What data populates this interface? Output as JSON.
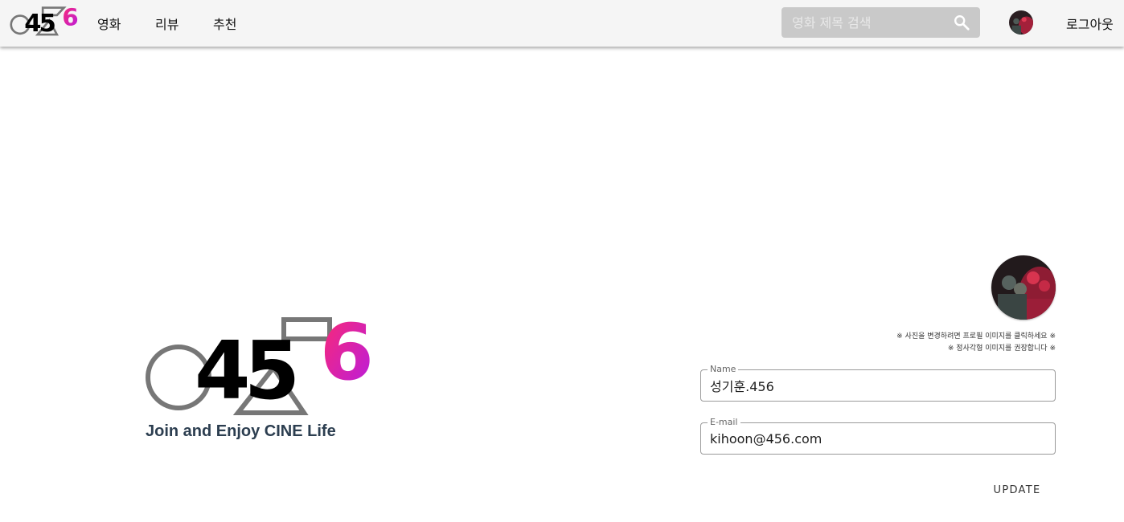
{
  "navbar": {
    "logo_text": "456",
    "items": [
      {
        "label": "영화"
      },
      {
        "label": "리뷰"
      },
      {
        "label": "추천"
      }
    ],
    "search": {
      "placeholder": "영화 제목 검색",
      "value": "",
      "icon": "search-icon"
    },
    "avatar_icon": "user-avatar",
    "logout_label": "로그아웃"
  },
  "brand": {
    "logo_text": "456",
    "tagline": "Join and Enjoy CINE Life"
  },
  "profile": {
    "hint_line1": "※ 사진을 변경하려면 프로필 이미지를 클릭하세요 ※",
    "hint_line2": "※ 정사각형 이미지를 권장합니다 ※",
    "name": {
      "label": "Name",
      "value": "성기훈.456"
    },
    "email": {
      "label": "E-mail",
      "value": "kihoon@456.com"
    },
    "update_label": "UPDATE"
  },
  "colors": {
    "navbar_bg": "#f5f5f5",
    "search_bg": "#c9c9c9",
    "tagline": "#2c3e50",
    "logo_pink": "#ff2d6f",
    "logo_purple": "#b020e0"
  }
}
